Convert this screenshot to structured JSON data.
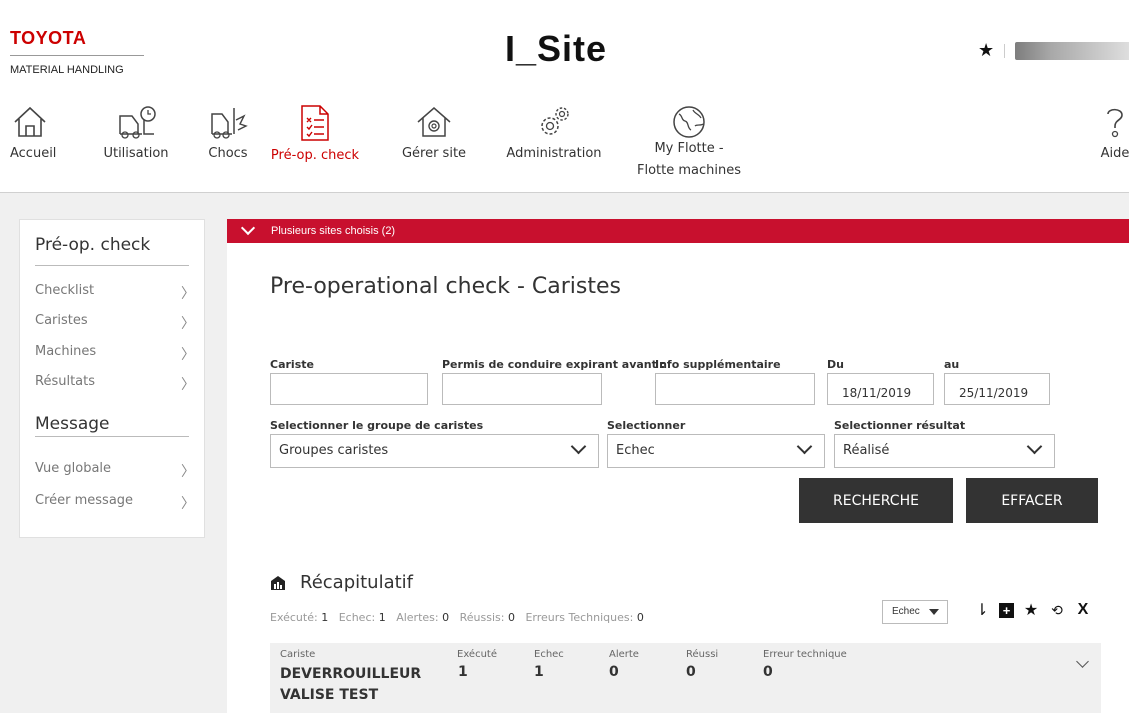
{
  "brand": {
    "name": "TOYOTA",
    "subtitle": "MATERIAL HANDLING"
  },
  "site_title": "I_Site",
  "colors": {
    "accent": "#c8102e",
    "dark_button": "#333333"
  },
  "nav": [
    {
      "label": "Accueil",
      "icon": "home-icon"
    },
    {
      "label": "Utilisation",
      "icon": "forklift-clock-icon"
    },
    {
      "label": "Chocs",
      "icon": "forklift-impact-icon"
    },
    {
      "label": "Pré-op. check",
      "icon": "checklist-icon",
      "active": true
    },
    {
      "label": "Gérer site",
      "icon": "site-settings-icon"
    },
    {
      "label": "Administration",
      "icon": "gears-icon"
    },
    {
      "label": "My Flotte -",
      "label2": "Flotte machines",
      "icon": "globe-icon"
    },
    {
      "label": "Aide",
      "icon": "help-icon"
    }
  ],
  "sidebar": {
    "section1": "Pré-op. check",
    "items1": [
      "Checklist",
      "Caristes",
      "Machines",
      "Résultats"
    ],
    "section2": "Message",
    "items2": [
      "Vue globale",
      "Créer message"
    ]
  },
  "banner": "Plusieurs sites choisis (2)",
  "page_title": "Pre-operational check - Caristes",
  "form": {
    "cariste_label": "Cariste",
    "cariste_value": "",
    "permis_label": "Permis de conduire expirant avant :",
    "permis_value": "",
    "info_label": "Info supplémentaire",
    "info_value": "",
    "du_label": "Du",
    "du_value": "18/11/2019",
    "au_label": "au",
    "au_value": "25/11/2019",
    "group_label": "Selectionner le groupe de caristes",
    "group_value": "Groupes caristes",
    "select_label": "Selectionner",
    "select_value": "Echec",
    "result_label": "Selectionner résultat",
    "result_value": "Réalisé",
    "search_button": "RECHERCHE",
    "clear_button": "EFFACER"
  },
  "summary": {
    "title": "Récapitulatif",
    "stats": [
      {
        "label": "Exécuté:",
        "value": "1"
      },
      {
        "label": "Echec:",
        "value": "1"
      },
      {
        "label": "Alertes:",
        "value": "0"
      },
      {
        "label": "Réussis:",
        "value": "0"
      },
      {
        "label": "Erreurs Techniques:",
        "value": "0"
      }
    ],
    "filter_value": "Echec",
    "tools": [
      "sort-icon",
      "add-icon",
      "star-icon",
      "export-icon",
      "clear-filter-icon"
    ]
  },
  "table": {
    "headers": [
      "Cariste",
      "Exécuté",
      "Echec",
      "Alerte",
      "Réussi",
      "Erreur technique"
    ],
    "rows": [
      {
        "name_line1": "DEVERROUILLEUR",
        "name_line2": "VALISE TEST",
        "executed": "1",
        "echec": "1",
        "alerte": "0",
        "reussi": "0",
        "erreur": "0"
      }
    ]
  }
}
